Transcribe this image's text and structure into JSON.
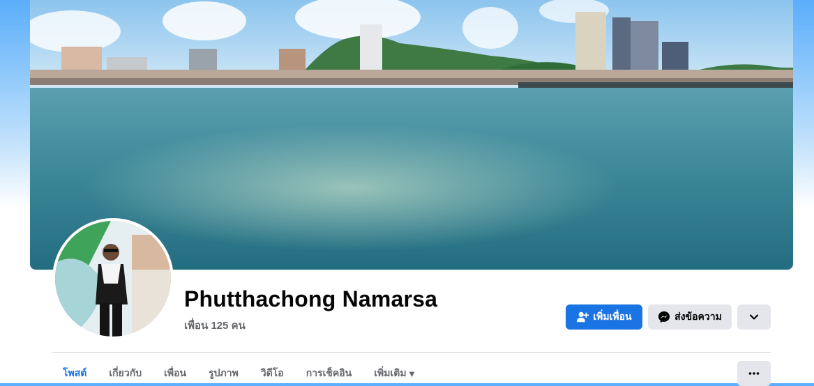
{
  "profile": {
    "name": "Phutthachong Namarsa",
    "friends_count": "เพื่อน 125 คน"
  },
  "actions": {
    "add_friend": "เพิ่มเพื่อน",
    "message": "ส่งข้อความ",
    "more_icon": "chevron-down-icon",
    "add_friend_icon": "add-friend-icon",
    "messenger_icon": "messenger-icon"
  },
  "tabs": [
    {
      "label": "โพสต์",
      "active": true
    },
    {
      "label": "เกี่ยวกับ"
    },
    {
      "label": "เพื่อน"
    },
    {
      "label": "รูปภาพ"
    },
    {
      "label": "วิดีโอ"
    },
    {
      "label": "การเช็คอิน"
    },
    {
      "label": "เพิ่มเติม"
    }
  ],
  "colors": {
    "accent": "#1b74e4",
    "secondary_button": "#e4e6eb",
    "muted_text": "#65676b"
  }
}
